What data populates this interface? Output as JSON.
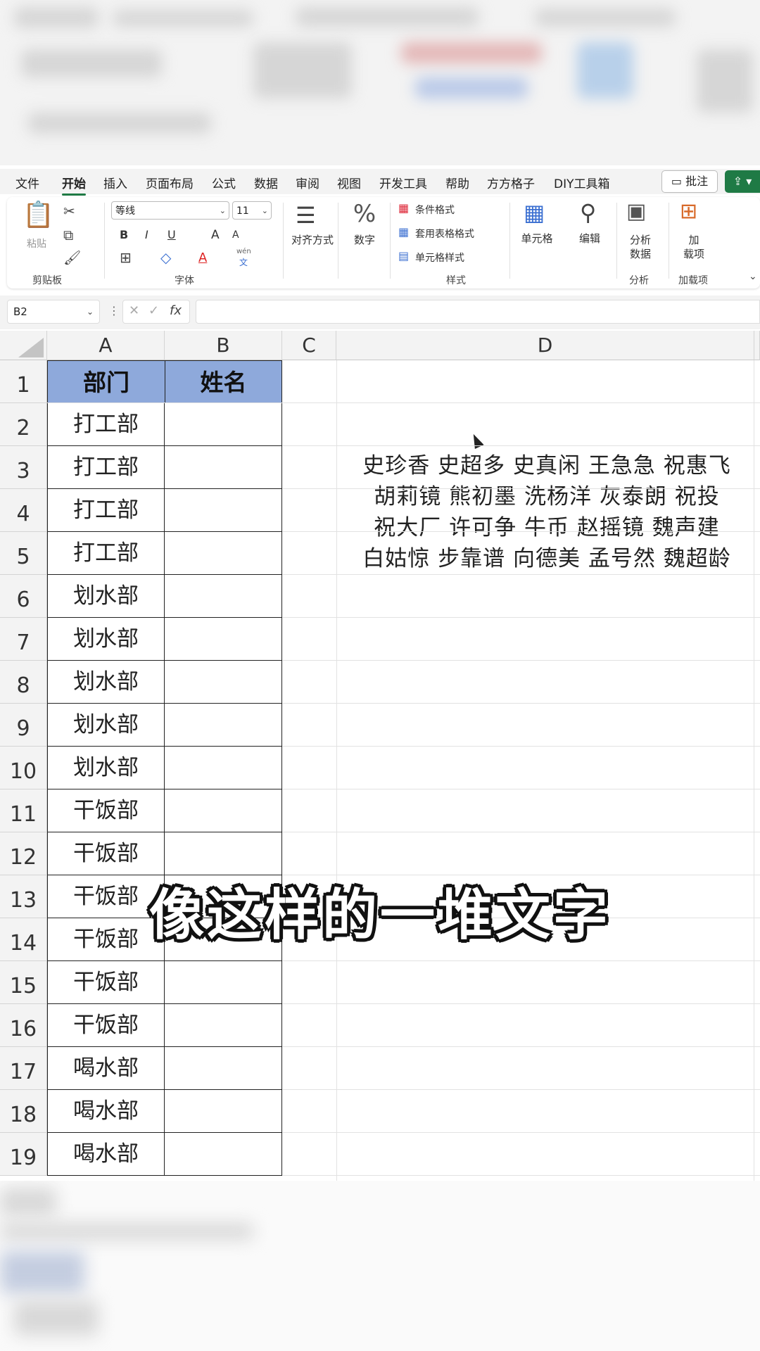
{
  "menu": {
    "items": [
      "文件",
      "开始",
      "插入",
      "页面布局",
      "公式",
      "数据",
      "审阅",
      "视图",
      "开发工具",
      "帮助",
      "方方格子",
      "DIY工具箱"
    ],
    "active": "开始",
    "comment_label": "批注"
  },
  "ribbon": {
    "paste_label": "粘贴",
    "font_name": "等线",
    "font_size": "11",
    "bold": "B",
    "italic": "I",
    "underline": "U",
    "grow_font": "A",
    "shrink_font": "A",
    "font_color": "A",
    "phonetic_top": "wén",
    "phonetic_bottom": "文",
    "align_label": "对齐方式",
    "number_label": "数字",
    "percent_symbol": "%",
    "conditional_format": "条件格式",
    "table_format": "套用表格格式",
    "cell_style": "单元格样式",
    "cells_label": "单元格",
    "edit_label": "编辑",
    "analyze_top": "分析",
    "analyze_bottom": "数据",
    "addin_top": "加",
    "addin_bottom": "载项",
    "groups": {
      "clipboard": "剪贴板",
      "font": "字体",
      "styles": "样式",
      "analysis": "分析",
      "addins": "加载项"
    }
  },
  "formula_bar": {
    "name_box": "B2",
    "fx": "fx",
    "formula": ""
  },
  "sheet": {
    "columns": [
      "A",
      "B",
      "C",
      "D"
    ],
    "headers": {
      "A": "部门",
      "B": "姓名"
    },
    "rows": [
      {
        "num": "1",
        "A": ""
      },
      {
        "num": "2",
        "A": "打工部"
      },
      {
        "num": "3",
        "A": "打工部"
      },
      {
        "num": "4",
        "A": "打工部"
      },
      {
        "num": "5",
        "A": "打工部"
      },
      {
        "num": "6",
        "A": "划水部"
      },
      {
        "num": "7",
        "A": "划水部"
      },
      {
        "num": "8",
        "A": "划水部"
      },
      {
        "num": "9",
        "A": "划水部"
      },
      {
        "num": "10",
        "A": "划水部"
      },
      {
        "num": "11",
        "A": "干饭部"
      },
      {
        "num": "12",
        "A": "干饭部"
      },
      {
        "num": "13",
        "A": "干饭部"
      },
      {
        "num": "14",
        "A": "干饭部"
      },
      {
        "num": "15",
        "A": "干饭部"
      },
      {
        "num": "16",
        "A": "干饭部"
      },
      {
        "num": "17",
        "A": "喝水部"
      },
      {
        "num": "18",
        "A": "喝水部"
      },
      {
        "num": "19",
        "A": "喝水部"
      }
    ],
    "d_text_lines": [
      "史珍香 史超多 史真闲 王急急 祝惠飞",
      "胡莉镜 熊初墨 洗杨洋 灰泰朗 祝投",
      "祝大厂 许可争 牛币 赵摇镜 魏声建",
      "白姑惊 步靠谱 向德美 孟号然 魏超龄"
    ]
  },
  "caption": "像这样的一堆文字",
  "colors": {
    "header_fill": "#8ea9db",
    "accent_green": "#1f7a45"
  }
}
